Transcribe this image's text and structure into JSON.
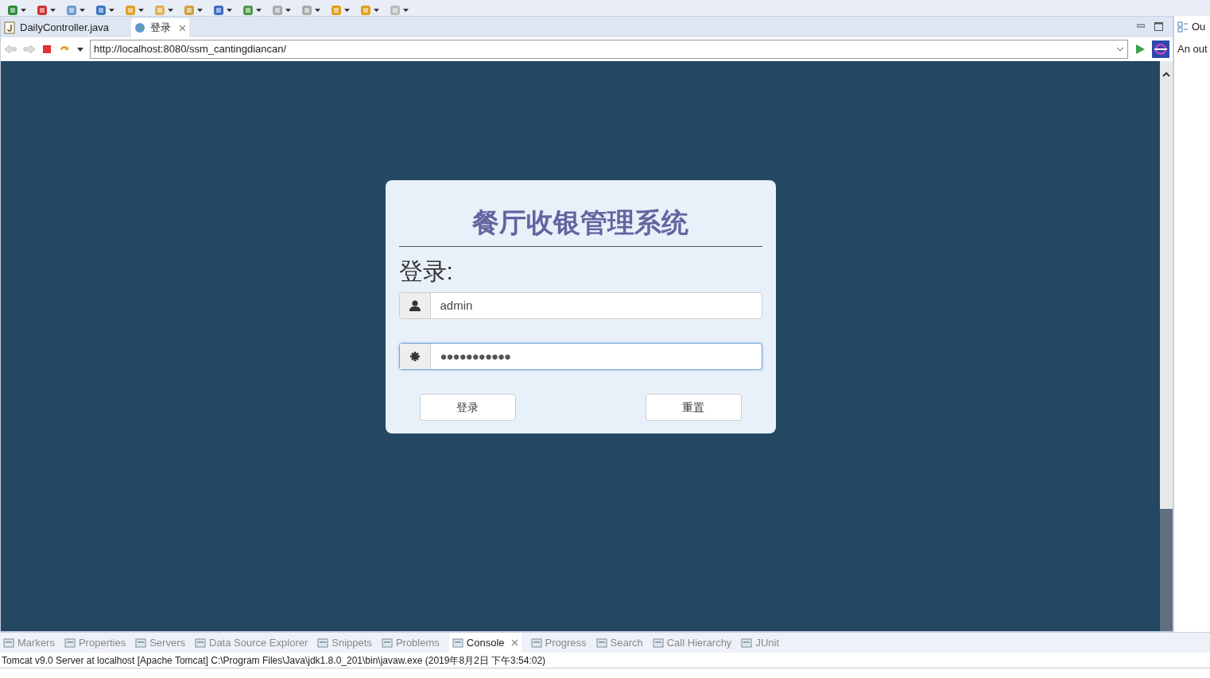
{
  "editor_tabs": [
    {
      "label": "DailyController.java",
      "kind": "java",
      "selected": false
    },
    {
      "label": "登录",
      "kind": "web",
      "selected": true
    }
  ],
  "browser": {
    "url": "http://localhost:8080/ssm_cantingdiancan/"
  },
  "outline": {
    "tab_label": "Ou",
    "message": "An out"
  },
  "login": {
    "title": "餐厅收银管理系统",
    "heading": "登录:",
    "username": {
      "value": "admin",
      "focused": false
    },
    "password": {
      "value": "●●●●●●●●●●●",
      "focused": true
    },
    "buttons": [
      "登录",
      "重置"
    ]
  },
  "bottom_tabs": [
    {
      "label": "Markers",
      "selected": false
    },
    {
      "label": "Properties",
      "selected": false
    },
    {
      "label": "Servers",
      "selected": false
    },
    {
      "label": "Data Source Explorer",
      "selected": false
    },
    {
      "label": "Snippets",
      "selected": false
    },
    {
      "label": "Problems",
      "selected": false
    },
    {
      "label": "Console",
      "selected": true
    },
    {
      "label": "Progress",
      "selected": false
    },
    {
      "label": "Search",
      "selected": false
    },
    {
      "label": "Call Hierarchy",
      "selected": false
    },
    {
      "label": "JUnit",
      "selected": false
    }
  ],
  "console": {
    "process": "Tomcat v9.0 Server at localhost [Apache Tomcat] C:\\Program Files\\Java\\jdk1.8.0_201\\bin\\javaw.exe (2019年8月2日 下午3:54:02)"
  }
}
